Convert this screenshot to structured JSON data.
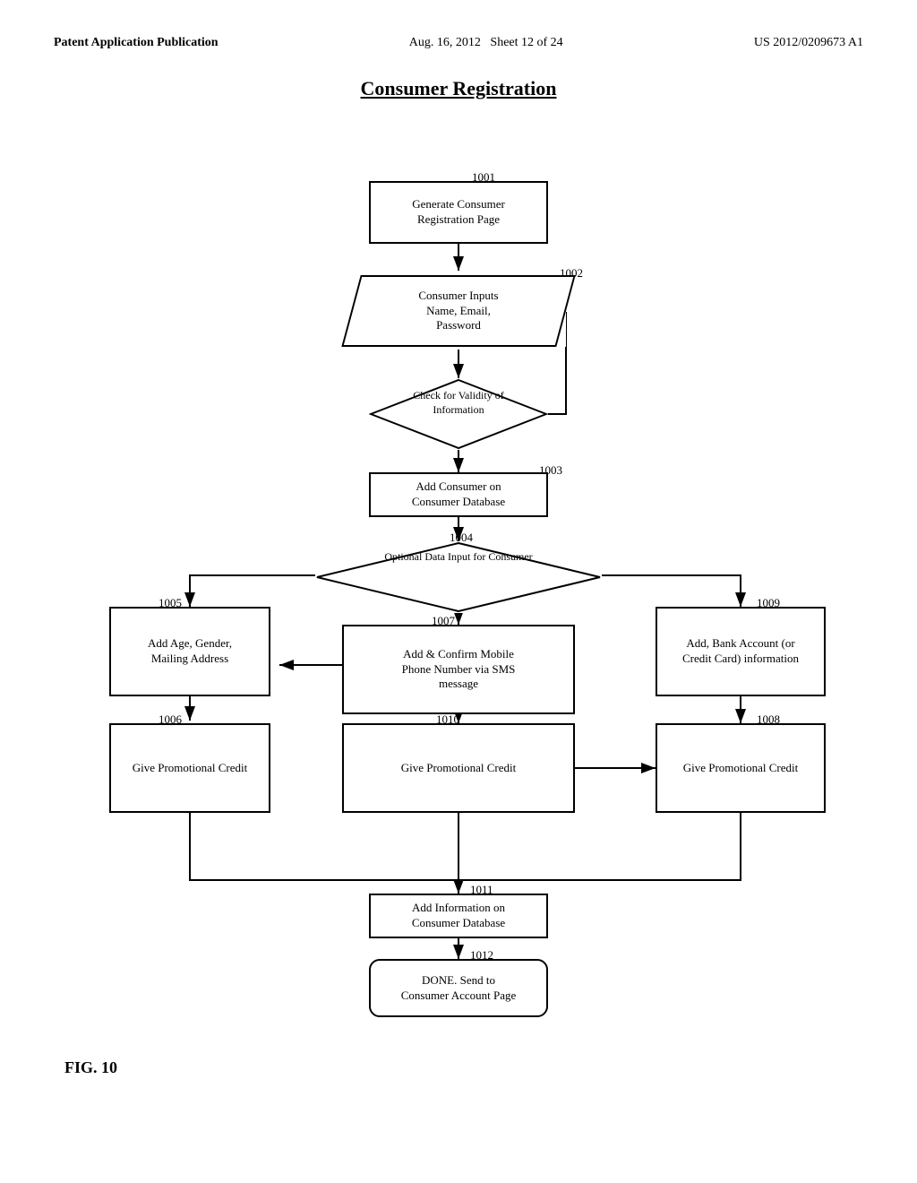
{
  "header": {
    "left": "Patent Application Publication",
    "center_date": "Aug. 16, 2012",
    "center_sheet": "Sheet 12 of 24",
    "right": "US 2012/0209673 A1"
  },
  "title": "Consumer Registration",
  "fig_label": "FIG. 10",
  "nodes": {
    "n1001": {
      "id": "1001",
      "label": "Generate Consumer\nRegistration Page"
    },
    "n1002": {
      "id": "1002",
      "label": "Consumer Inputs\nName, Email,\nPassword"
    },
    "ncheck": {
      "id": "",
      "label": "Check for Validity of\nInformation"
    },
    "n1003": {
      "id": "1003",
      "label": "Add Consumer on\nConsumer Database"
    },
    "n1004": {
      "id": "1004",
      "label": "Optional Data Input for\nConsumer"
    },
    "n1005": {
      "id": "1005",
      "label": "Add Age, Gender,\nMailing Address"
    },
    "n1007": {
      "id": "1007",
      "label": "Add & Confirm Mobile\nPhone Number via SMS\nmessage"
    },
    "n1009": {
      "id": "1009",
      "label": "Add, Bank Account (or\nCredit Card) information"
    },
    "n1006": {
      "id": "1006",
      "label": "Give Promotional Credit"
    },
    "n1010": {
      "id": "1010",
      "label": "Give Promotional Credit"
    },
    "n1008": {
      "id": "1008",
      "label": "Give Promotional Credit"
    },
    "n1011": {
      "id": "1011",
      "label": "Add Information on\nConsumer Database"
    },
    "n1012": {
      "id": "1012",
      "label": "DONE. Send to\nConsumer Account Page"
    }
  }
}
